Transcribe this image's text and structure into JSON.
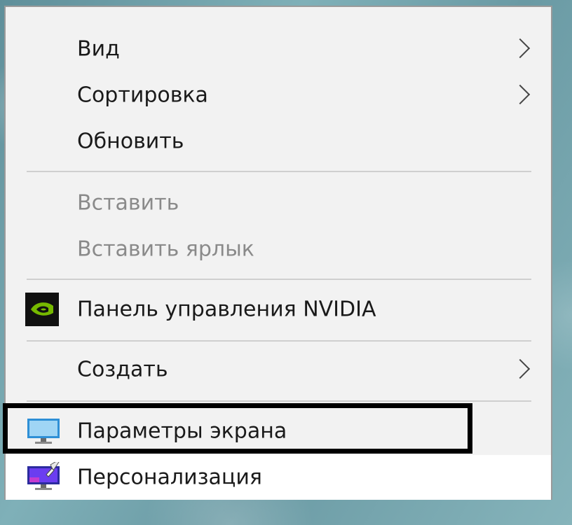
{
  "menu": {
    "items": [
      {
        "label": "Вид",
        "has_submenu": true,
        "disabled": false
      },
      {
        "label": "Сортировка",
        "has_submenu": true,
        "disabled": false
      },
      {
        "label": "Обновить",
        "has_submenu": false,
        "disabled": false
      },
      {
        "label": "Вставить",
        "has_submenu": false,
        "disabled": true
      },
      {
        "label": "Вставить ярлык",
        "has_submenu": false,
        "disabled": true
      },
      {
        "label": "Панель управления NVIDIA",
        "has_submenu": false,
        "disabled": false,
        "icon": "nvidia-icon"
      },
      {
        "label": "Создать",
        "has_submenu": true,
        "disabled": false
      },
      {
        "label": "Параметры экрана",
        "has_submenu": false,
        "disabled": false,
        "icon": "display-settings-icon",
        "highlighted": true
      },
      {
        "label": "Персонализация",
        "has_submenu": false,
        "disabled": false,
        "icon": "personalization-icon"
      }
    ]
  },
  "colors": {
    "menu_bg": "#f2f2f2",
    "text": "#1a1a1a",
    "disabled_text": "#8a8a8a",
    "separator": "#cfcfcf",
    "highlight_border": "#000000",
    "nvidia_green": "#76b900"
  }
}
